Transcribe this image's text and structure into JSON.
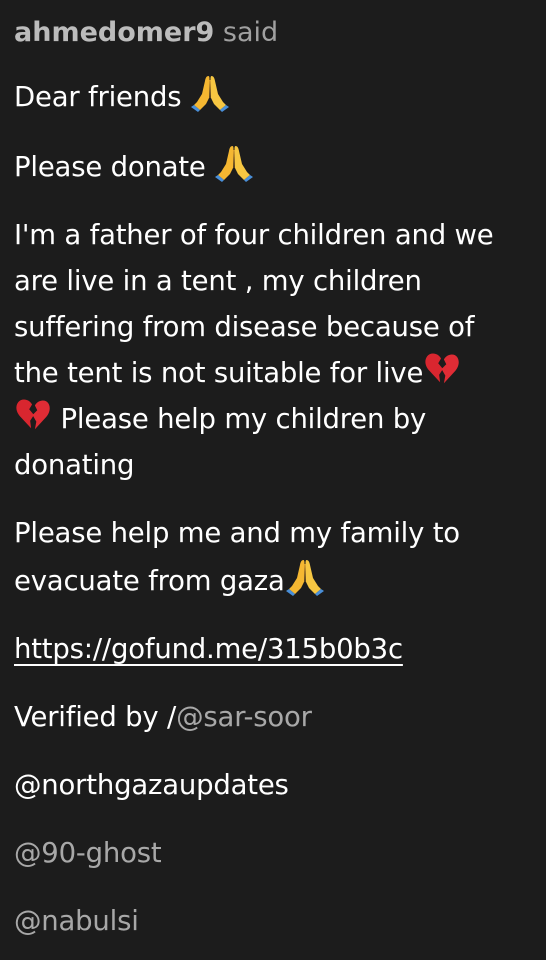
{
  "post": {
    "username": "ahmedomer9",
    "said_label": "said",
    "paragraphs": {
      "p1": "Dear friends",
      "p2": "Please donate",
      "p3_line1": "I'm a father of four children and we",
      "p3_line2": "are live in a tent , my children",
      "p3_line3": "suffering from disease because of",
      "p3_line4": "the tent is not suitable for live",
      "p3_line5": "Please help my children by",
      "p3_line6": "donating",
      "p4_line1": "Please help me and my family to",
      "p4_line2": "evacuate from gaza"
    },
    "link": "https://gofund.me/315b0b3c",
    "verified_prefix": "Verified by /",
    "mentions": {
      "sar_soor": "@sar-soor",
      "northgazaupdates": "@northgazaupdates",
      "ghost": "@90-ghost",
      "nabulsi": "@nabulsi"
    },
    "icons": {
      "praying_hands": "folded-hands-emoji",
      "broken_heart": "broken-heart-emoji"
    },
    "colors": {
      "background": "#1c1c1c",
      "text": "#ffffff",
      "muted": "#a8a8a8"
    }
  }
}
